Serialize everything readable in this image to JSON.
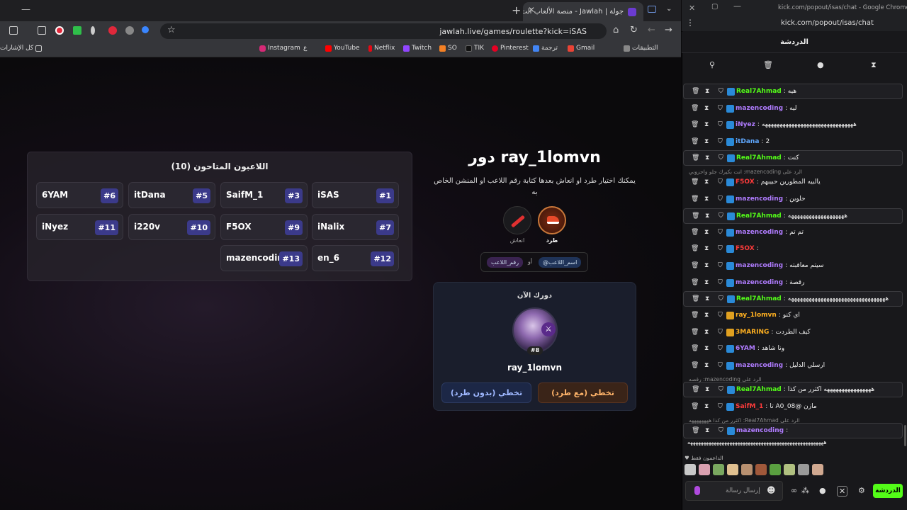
{
  "browser": {
    "tab_title": "جولة | Jawlah - منصة الألعاب الت",
    "url": "jawlah.live/games/roulette?kick=iSAS",
    "bookmarks": [
      "التطبيقات",
      "Gmail",
      "ترجمة",
      "Pinterest",
      "TIK",
      "SO",
      "Twitch",
      "Netflix",
      "YouTube",
      "ع",
      "Instagram",
      "كل الإشارات"
    ]
  },
  "game": {
    "panel_title": "اللاعبون المتاحون (10)",
    "players": [
      {
        "rank": "#1",
        "name": "iSAS"
      },
      {
        "rank": "#3",
        "name": "SaifM_1"
      },
      {
        "rank": "#5",
        "name": "itDana"
      },
      {
        "rank": "#6",
        "name": "6YAM"
      },
      {
        "rank": "#7",
        "name": "iNalix"
      },
      {
        "rank": "#9",
        "name": "F5OX"
      },
      {
        "rank": "#10",
        "name": "i220v"
      },
      {
        "rank": "#11",
        "name": "iNyez"
      },
      {
        "rank": "#12",
        "name": "en_6"
      },
      {
        "rank": "#13",
        "name": "mazencodin..."
      }
    ],
    "turn_title": "دور ray_1lomvn",
    "instructions": "يمكنك اختيار طرد او انعاش بعدها كتابة رقم اللاعب او المنشن الخاص به",
    "kick_label": "طرد",
    "revive_label": "انعاش",
    "mention_chip": "@اسم_اللاعب",
    "or_label": "أو",
    "number_chip": "رقم_اللاعب",
    "current_title": "دورك الآن",
    "current_badge": "#8",
    "current_name": "ray_1lomvn",
    "skip_with_kick": "تخطي (مع طرد)",
    "skip_no_kick": "تخطي (بدون طرد)"
  },
  "chat_window": {
    "window_title": "kick.com/popout/isas/chat - Google Chrome",
    "url": "kick.com/popout/isas/chat",
    "header": "الدردشة",
    "messages": [
      {
        "user": "Real7Ahmad",
        "text": "هيه",
        "color": "#53fc18",
        "hl": true
      },
      {
        "user": "mazencoding",
        "text": "ليه",
        "color": "#b07cff",
        "hl": false
      },
      {
        "user": "iNyez",
        "text": "هههههههههههههههههههههههههههههههه",
        "color": "#b07cff",
        "hl": false
      },
      {
        "user": "itDana",
        "text": "2",
        "color": "#5fa8ff",
        "hl": false
      },
      {
        "user": "Real7Ahmad",
        "text": "كنت",
        "color": "#53fc18",
        "hl": true
      },
      {
        "user": "F5OX",
        "text": "يالبيه المطورين حبيبهم",
        "color": "#ff3b3b",
        "hl": false
      },
      {
        "user": "mazencoding",
        "text": "حلوين",
        "color": "#b07cff",
        "hl": false
      },
      {
        "user": "Real7Ahmad",
        "text": "هههههههههههههههههههه",
        "color": "#53fc18",
        "hl": true
      },
      {
        "user": "mazencoding",
        "text": "تم تم",
        "color": "#b07cff",
        "hl": false
      },
      {
        "user": "F5OX",
        "text": "",
        "color": "#ff3b3b",
        "hl": false
      },
      {
        "user": "mazencoding",
        "text": "سيتم معاقبته",
        "color": "#b07cff",
        "hl": false
      },
      {
        "user": "mazencoding",
        "text": "رقصة",
        "color": "#b07cff",
        "hl": false
      },
      {
        "user": "Real7Ahmad",
        "text": "هههههههههههههههههههههههههههههههههه",
        "color": "#53fc18",
        "hl": true
      },
      {
        "user": "ray_1lomvn",
        "text": "اي كنو",
        "color": "#ffb020",
        "hl": false
      },
      {
        "user": "3MARING",
        "text": "كيف الطردت",
        "color": "#ffb020",
        "hl": false
      },
      {
        "user": "6YAM",
        "text": "ونا شاهد",
        "color": "#b07cff",
        "hl": false
      },
      {
        "user": "mazencoding",
        "text": "ارسلي الدليل",
        "color": "#b07cff",
        "hl": false
      },
      {
        "user": "Real7Ahmad",
        "text": "ههههههههههههههههه اكثرر من كذا",
        "color": "#53fc18",
        "hl": true
      },
      {
        "user": "SaifM_1",
        "text": "مازن @A0_08 تا",
        "color": "#ff3b3b",
        "hl": false
      },
      {
        "user": "mazencoding",
        "text": "",
        "color": "#b07cff",
        "hl": true
      }
    ],
    "replies": [
      "الرد على mazencoding: انت بكيرك جلو واحزوني",
      "الرد على mazencoding: رقصه",
      "الرد على Real7Ahmad: اكثرر من كذا ههههههههه"
    ],
    "long_line": "ههههههههههههههههههههههههههههههههههههههههههههههههههههه",
    "supporters_label": "الداعمون فقط",
    "input_placeholder": "إرسال رسالة",
    "send_label": "الدردشة"
  }
}
